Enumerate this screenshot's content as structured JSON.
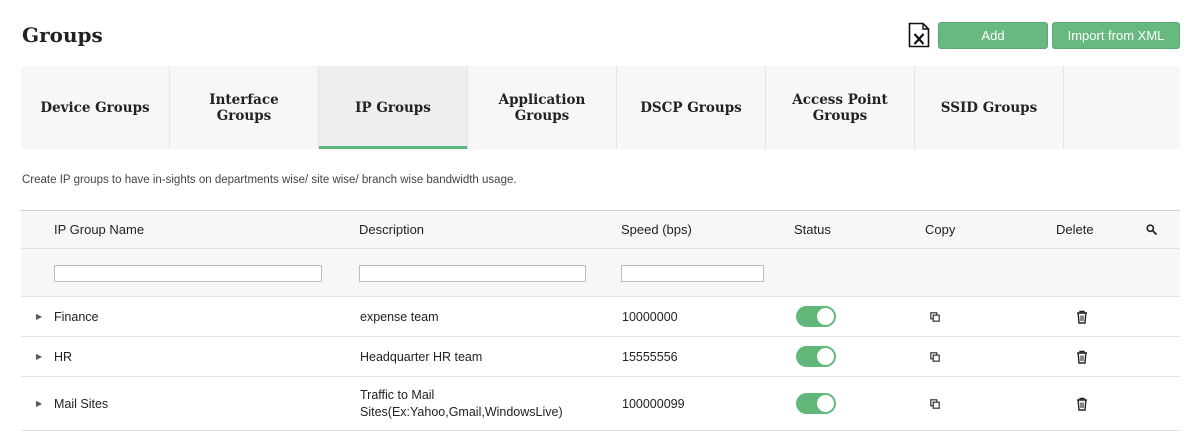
{
  "page": {
    "title": "Groups"
  },
  "actions": {
    "add_label": "Add",
    "import_label": "Import from XML"
  },
  "tabs": [
    {
      "label": "Device Groups"
    },
    {
      "label": "Interface Groups"
    },
    {
      "label": "IP Groups"
    },
    {
      "label": "Application Groups"
    },
    {
      "label": "DSCP Groups"
    },
    {
      "label": "Access Point Groups"
    },
    {
      "label": "SSID Groups"
    }
  ],
  "active_tab": "IP Groups",
  "description": "Create IP groups to have in-sights on departments wise/ site wise/ branch wise bandwidth usage.",
  "table": {
    "columns": {
      "name": "IP Group Name",
      "description": "Description",
      "speed": "Speed (bps)",
      "status": "Status",
      "copy": "Copy",
      "delete": "Delete"
    },
    "filters": {
      "name": "",
      "description": "",
      "speed": ""
    },
    "rows": [
      {
        "name": "Finance",
        "description_line1": "expense team",
        "description_line2": "",
        "speed": "10000000",
        "status": "on"
      },
      {
        "name": "HR",
        "description_line1": "Headquarter HR team",
        "description_line2": "",
        "speed": "15555556",
        "status": "on"
      },
      {
        "name": "Mail Sites",
        "description_line1": "Traffic to Mail",
        "description_line2": "Sites(Ex:Yahoo,Gmail,WindowsLive)",
        "speed": "100000099",
        "status": "on"
      }
    ]
  },
  "colors": {
    "accent": "#67b97f",
    "tab_bg": "#f7f7f7",
    "active_underline": "#5cb97b"
  },
  "icons": {
    "export": "excel-export-icon",
    "search": "search-icon",
    "expand": "expand-arrow-icon",
    "copy": "copy-icon",
    "delete": "trash-icon"
  }
}
